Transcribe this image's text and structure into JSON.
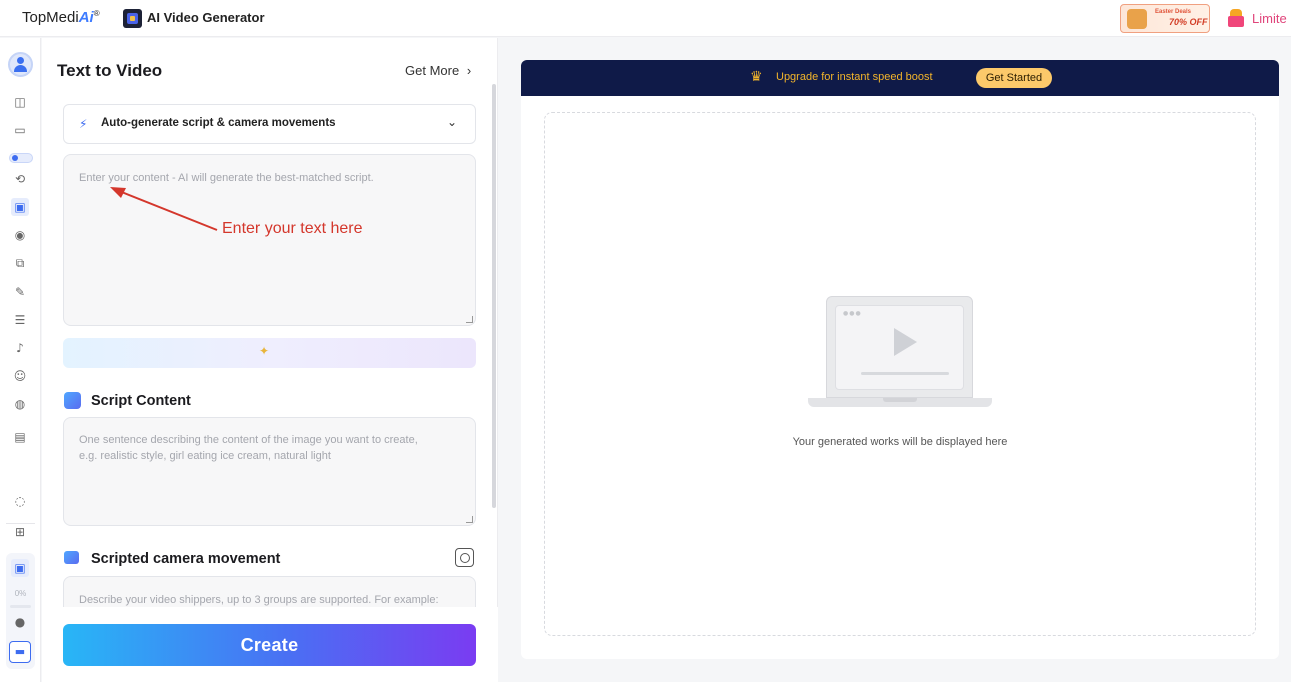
{
  "header": {
    "brand_prefix": "TopMedi",
    "brand_ai": "Ai",
    "brand_mark": "®",
    "app_title": "AI Video Generator",
    "promo_top": "Easter Deals",
    "promo_main": "70% OFF",
    "limited_label": "Limite"
  },
  "sidebar": {
    "progress_percent": "0%",
    "icons": [
      "avatar-icon",
      "image-icon",
      "folder-icon",
      "toggle-icon",
      "face-swap-icon",
      "video-icon",
      "audio-icon",
      "copy-icon",
      "pen-icon",
      "document-icon",
      "microphone-icon",
      "people-icon",
      "globe-icon",
      "toolbox-icon",
      "chat-icon",
      "apps-icon",
      "task-icon",
      "info-icon",
      "card-icon"
    ]
  },
  "panel": {
    "title": "Text to Video",
    "get_more": "Get More",
    "get_more_chevron": "›",
    "mode_select": "Auto-generate script & camera movements",
    "content_placeholder": "Enter your content - AI will generate the best-matched script.",
    "annotation": "Enter your text here",
    "script_section_title": "Script Content",
    "script_placeholder_line1": "One sentence describing the content of the image you want to create,",
    "script_placeholder_line2": "e.g. realistic style, girl eating ice cream, natural light",
    "camera_section_title": "Scripted camera movement",
    "camera_placeholder": "Describe your video shippers, up to 3 groups are supported. For example:",
    "create_label": "Create"
  },
  "preview": {
    "upgrade_text": "Upgrade for instant speed boost",
    "get_started": "Get Started",
    "empty_text": "Your generated works will be displayed here"
  }
}
